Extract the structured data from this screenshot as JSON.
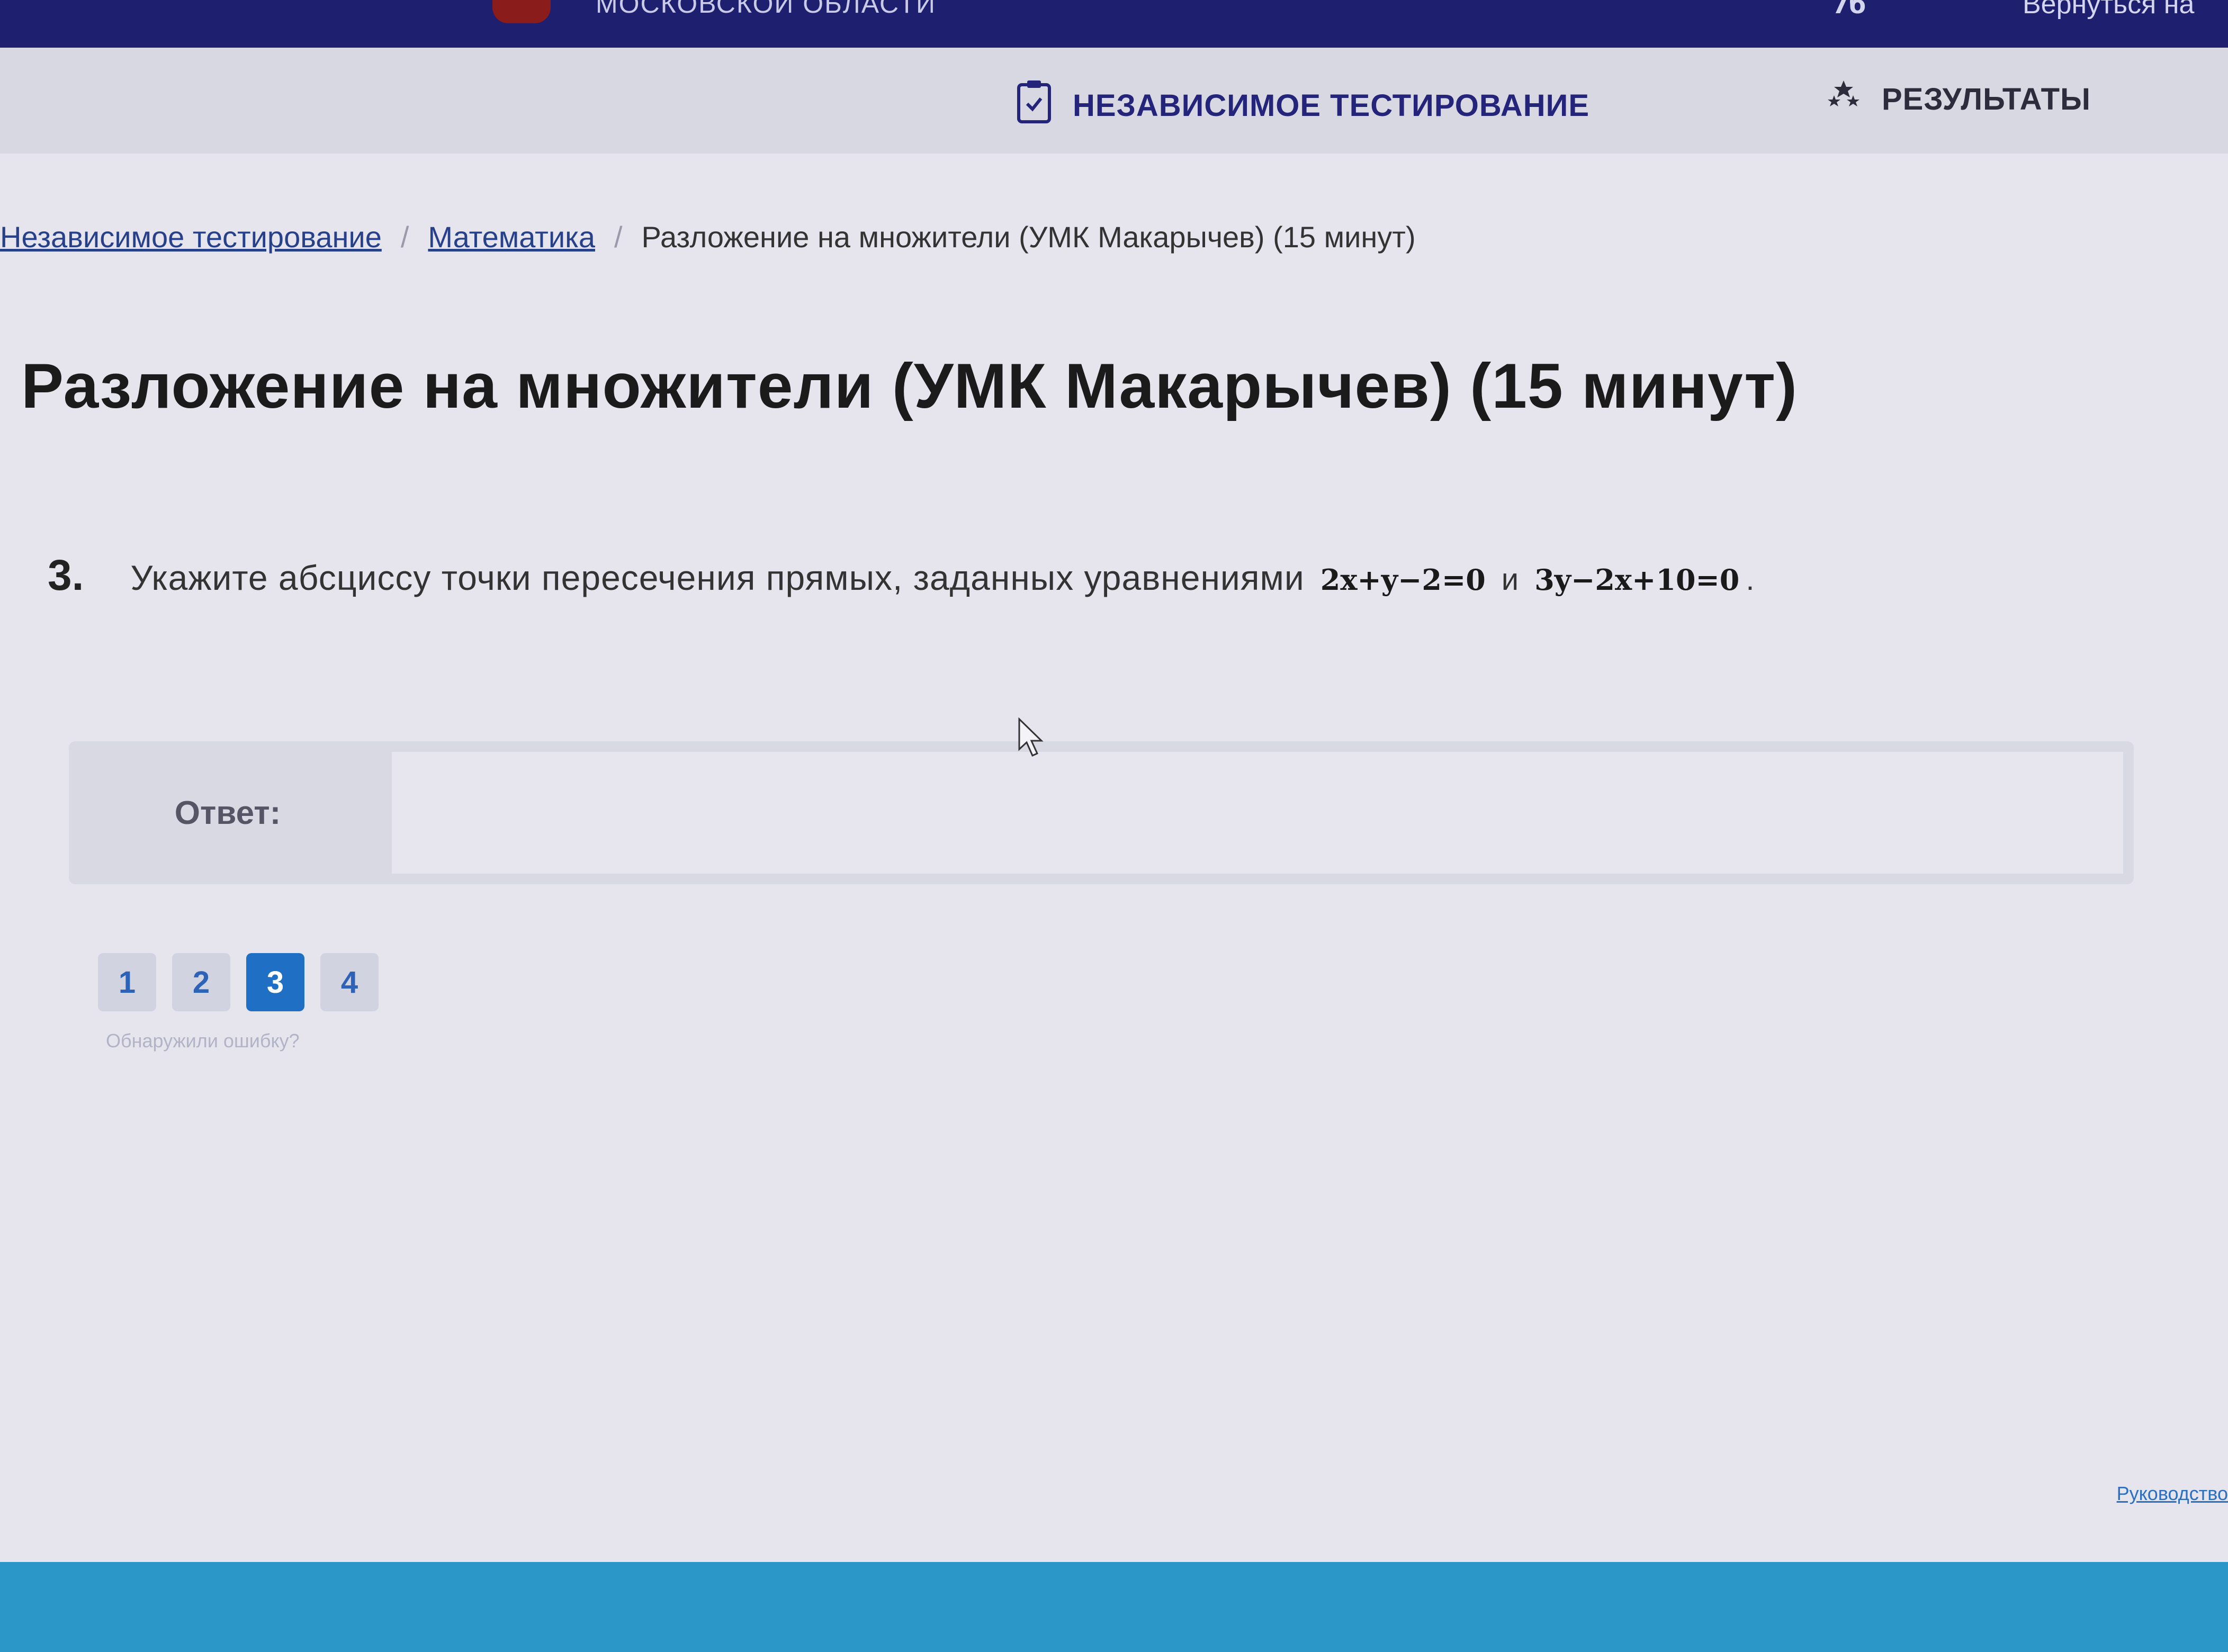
{
  "topbar": {
    "region_text": "МОСКОВСКОЙ ОБЛАСТИ",
    "user_text": "7б",
    "back_text": "Вернуться на"
  },
  "nav": {
    "test_label": "НЕЗАВИСИМОЕ ТЕСТИРОВАНИЕ",
    "results_label": "РЕЗУЛЬТАТЫ"
  },
  "breadcrumb": {
    "items": [
      "Независимое тестирование",
      "Математика"
    ],
    "separator": "/",
    "current": "Разложение на множители (УМК Макарычев) (15 минут)"
  },
  "page_title": "Разложение на множители (УМК Макарычев) (15 минут)",
  "question": {
    "number": "3.",
    "text": "Укажите абсциссу точки пересечения прямых, заданных уравнениями",
    "formula_1": "2x+y−2=0",
    "conjunction": "и",
    "formula_2": "3y−2x+10=0",
    "end": "."
  },
  "answer": {
    "label": "Ответ:",
    "value": ""
  },
  "pager": {
    "pages": [
      "1",
      "2",
      "3",
      "4"
    ],
    "active": "3",
    "error_link": "Обнаружили ошибку?"
  },
  "footer": {
    "link": "Руководство"
  },
  "colors": {
    "topbar": "#1e1f6e",
    "accent": "#1f6fc4",
    "footer": "#2a97c8"
  }
}
